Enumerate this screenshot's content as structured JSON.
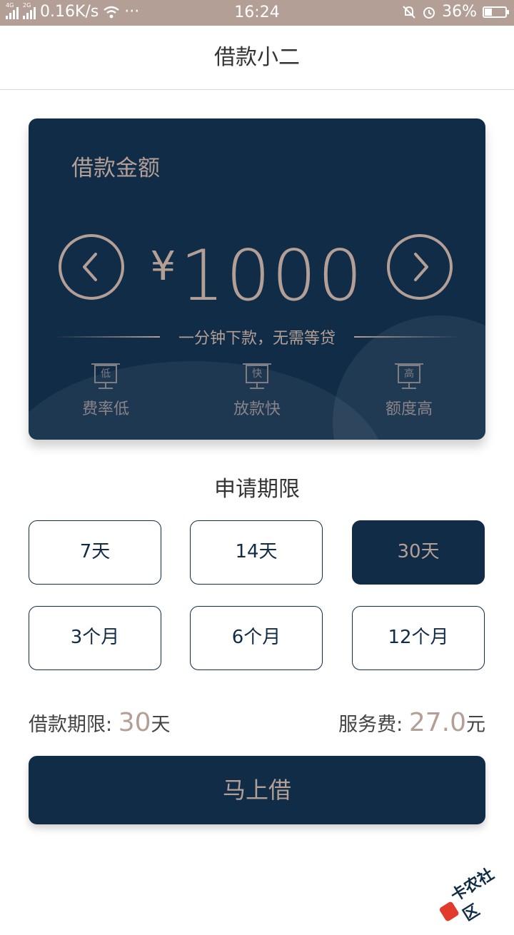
{
  "statusbar": {
    "net1": "4G",
    "net2": "2G",
    "speed": "0.16K/s",
    "dots": "···",
    "time": "16:24",
    "battery": "36%",
    "battery_level": 0.36
  },
  "navbar": {
    "title": "借款小二"
  },
  "card": {
    "label": "借款金额",
    "currency": "¥",
    "amount": "1000",
    "tagline": "一分钟下款，无需等贷",
    "features": [
      {
        "icon_char": "低",
        "label": "费率低"
      },
      {
        "icon_char": "快",
        "label": "放款快"
      },
      {
        "icon_char": "高",
        "label": "额度高"
      }
    ]
  },
  "term_section": {
    "title": "申请期限",
    "options": [
      "7天",
      "14天",
      "30天",
      "3个月",
      "6个月",
      "12个月"
    ],
    "selected": "30天"
  },
  "summary": {
    "term_label": "借款期限: ",
    "term_value": "30",
    "term_unit": "天",
    "fee_label": "服务费: ",
    "fee_value": "27.0",
    "fee_unit": "元"
  },
  "action": {
    "borrow_label": "马上借"
  },
  "watermark": {
    "text": "卡农社区"
  },
  "colors": {
    "navy": "#102c47",
    "gold": "#b49f97",
    "statusbar": "#b49f97"
  }
}
